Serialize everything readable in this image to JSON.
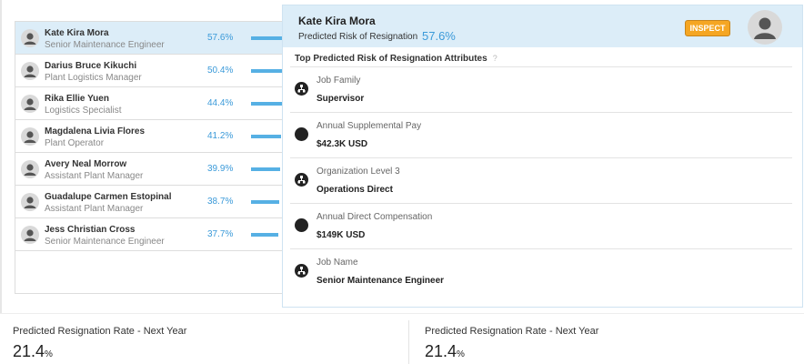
{
  "employees": [
    {
      "name": "Kate Kira Mora",
      "title": "Senior Maintenance Engineer",
      "risk": "57.6%",
      "risk_value": 57.6,
      "selected": true
    },
    {
      "name": "Darius Bruce Kikuchi",
      "title": "Plant Logistics Manager",
      "risk": "50.4%",
      "risk_value": 50.4,
      "selected": false
    },
    {
      "name": "Rika Ellie Yuen",
      "title": "Logistics Specialist",
      "risk": "44.4%",
      "risk_value": 44.4,
      "selected": false
    },
    {
      "name": "Magdalena Livia Flores",
      "title": "Plant Operator",
      "risk": "41.2%",
      "risk_value": 41.2,
      "selected": false
    },
    {
      "name": "Avery Neal Morrow",
      "title": "Assistant Plant Manager",
      "risk": "39.9%",
      "risk_value": 39.9,
      "selected": false
    },
    {
      "name": "Guadalupe Carmen Estopinal",
      "title": "Assistant Plant Manager",
      "risk": "38.7%",
      "risk_value": 38.7,
      "selected": false
    },
    {
      "name": "Jess Christian Cross",
      "title": "Senior Maintenance Engineer",
      "risk": "37.7%",
      "risk_value": 37.7,
      "selected": false
    }
  ],
  "detail": {
    "name": "Kate Kira Mora",
    "risk_label": "Predicted Risk of Resignation",
    "risk_value": "57.6%",
    "inspect_label": "INSPECT",
    "attributes_heading": "Top Predicted Risk of Resignation Attributes",
    "help_glyph": "?",
    "attributes": [
      {
        "label": "Job Family",
        "value": "Supervisor",
        "icon": "org-chart-icon"
      },
      {
        "label": "Annual Supplemental Pay",
        "value": "$42.3K USD",
        "icon": "dot-icon"
      },
      {
        "label": "Organization Level 3",
        "value": "Operations Direct",
        "icon": "org-chart-icon"
      },
      {
        "label": "Annual Direct Compensation",
        "value": "$149K USD",
        "icon": "dot-icon"
      },
      {
        "label": "Job Name",
        "value": "Senior Maintenance Engineer",
        "icon": "org-chart-icon"
      }
    ]
  },
  "metrics": [
    {
      "label": "Predicted Resignation Rate - Next Year",
      "value": "21.4",
      "unit": "%"
    },
    {
      "label": "Predicted Resignation Rate - Next Year",
      "value": "21.4",
      "unit": "%"
    }
  ],
  "colors": {
    "accent": "#3b9ad9",
    "bar": "#56b0e4",
    "selected_row": "#dcedf8",
    "inspect": "#f5a623"
  }
}
